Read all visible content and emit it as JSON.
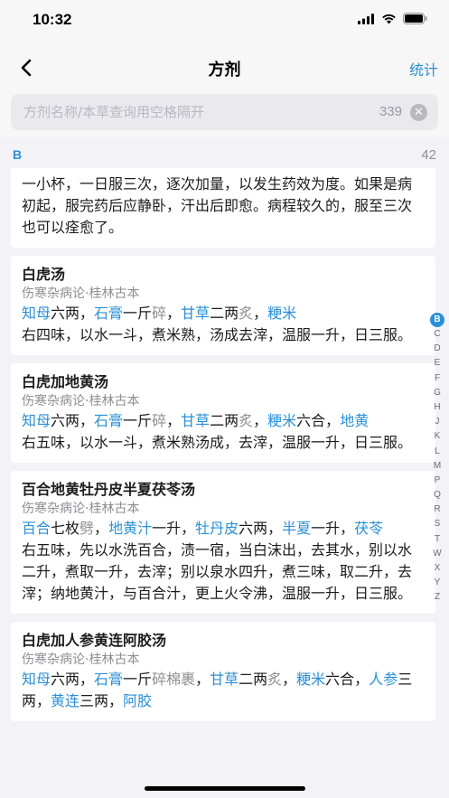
{
  "status": {
    "time": "10:32"
  },
  "nav": {
    "title": "方剂",
    "action": "统计"
  },
  "search": {
    "placeholder": "方剂名称/本草查询用空格隔开",
    "value": "",
    "count": "339"
  },
  "section": {
    "letter": "B",
    "count": "42"
  },
  "colors": {
    "accent": "#2b8fd6",
    "text": "#1c1c1e",
    "muted": "#8e8e93",
    "background": "#f2f2f7"
  },
  "cards": [
    {
      "title": "",
      "source": "",
      "ingredients": [],
      "body": "一小杯，一日服三次，逐次加量，以发生药效为度。如果是病初起，服完药后应静卧，汗出后即愈。病程较久的，服至三次也可以痊愈了。"
    },
    {
      "title": "白虎汤",
      "source": "伤寒杂病论·桂林古本",
      "ingredients": [
        {
          "t": "知母",
          "k": "herb"
        },
        {
          "t": "六两，",
          "k": "text"
        },
        {
          "t": "石膏",
          "k": "herb"
        },
        {
          "t": "一斤",
          "k": "text"
        },
        {
          "t": "碎",
          "k": "note"
        },
        {
          "t": "，",
          "k": "text"
        },
        {
          "t": "甘草",
          "k": "herb"
        },
        {
          "t": "二两",
          "k": "text"
        },
        {
          "t": "炙",
          "k": "note"
        },
        {
          "t": "，",
          "k": "text"
        },
        {
          "t": "粳米",
          "k": "herb"
        }
      ],
      "body": "右四味，以水一斗，煮米熟，汤成去滓，温服一升，日三服。"
    },
    {
      "title": "白虎加地黄汤",
      "source": "伤寒杂病论·桂林古本",
      "ingredients": [
        {
          "t": "知母",
          "k": "herb"
        },
        {
          "t": "六两，",
          "k": "text"
        },
        {
          "t": "石膏",
          "k": "herb"
        },
        {
          "t": "一斤",
          "k": "text"
        },
        {
          "t": "碎",
          "k": "note"
        },
        {
          "t": "，",
          "k": "text"
        },
        {
          "t": "甘草",
          "k": "herb"
        },
        {
          "t": "二两",
          "k": "text"
        },
        {
          "t": "炙",
          "k": "note"
        },
        {
          "t": "，",
          "k": "text"
        },
        {
          "t": "粳米",
          "k": "herb"
        },
        {
          "t": "六合，",
          "k": "text"
        },
        {
          "t": "地黄",
          "k": "herb"
        }
      ],
      "body": "右五味，以水一斗，煮米熟汤成，去滓，温服一升，日三服。"
    },
    {
      "title": "百合地黄牡丹皮半夏茯苓汤",
      "source": "伤寒杂病论·桂林古本",
      "ingredients": [
        {
          "t": "百合",
          "k": "herb"
        },
        {
          "t": "七枚",
          "k": "text"
        },
        {
          "t": "劈",
          "k": "note"
        },
        {
          "t": "，",
          "k": "text"
        },
        {
          "t": "地黄汁",
          "k": "herb"
        },
        {
          "t": "一升，",
          "k": "text"
        },
        {
          "t": "牡丹皮",
          "k": "herb"
        },
        {
          "t": "六两，",
          "k": "text"
        },
        {
          "t": "半夏",
          "k": "herb"
        },
        {
          "t": "一升，",
          "k": "text"
        },
        {
          "t": "茯苓",
          "k": "herb"
        }
      ],
      "body": "右五味，先以水洗百合，渍一宿，当白沫出，去其水，别以水二升，煮取一升，去滓；别以泉水四升，煮三味，取二升，去滓；纳地黄汁，与百合汁，更上火令沸，温服一升，日三服。"
    },
    {
      "title": "白虎加人参黄连阿胶汤",
      "source": "伤寒杂病论·桂林古本",
      "ingredients": [
        {
          "t": "知母",
          "k": "herb"
        },
        {
          "t": "六两，",
          "k": "text"
        },
        {
          "t": "石膏",
          "k": "herb"
        },
        {
          "t": "一斤",
          "k": "text"
        },
        {
          "t": "碎棉裹",
          "k": "note"
        },
        {
          "t": "，",
          "k": "text"
        },
        {
          "t": "甘草",
          "k": "herb"
        },
        {
          "t": "二两",
          "k": "text"
        },
        {
          "t": "炙",
          "k": "note"
        },
        {
          "t": "，",
          "k": "text"
        },
        {
          "t": "粳米",
          "k": "herb"
        },
        {
          "t": "六合，",
          "k": "text"
        },
        {
          "t": "人参",
          "k": "herb"
        },
        {
          "t": "三两，",
          "k": "text"
        },
        {
          "t": "黄连",
          "k": "herb"
        },
        {
          "t": "三两，",
          "k": "text"
        },
        {
          "t": "阿胶",
          "k": "herb"
        }
      ],
      "body": ""
    }
  ],
  "index": [
    "B",
    "C",
    "D",
    "E",
    "F",
    "G",
    "H",
    "J",
    "K",
    "L",
    "M",
    "P",
    "Q",
    "R",
    "S",
    "T",
    "W",
    "X",
    "Y",
    "Z"
  ],
  "index_active": "B"
}
